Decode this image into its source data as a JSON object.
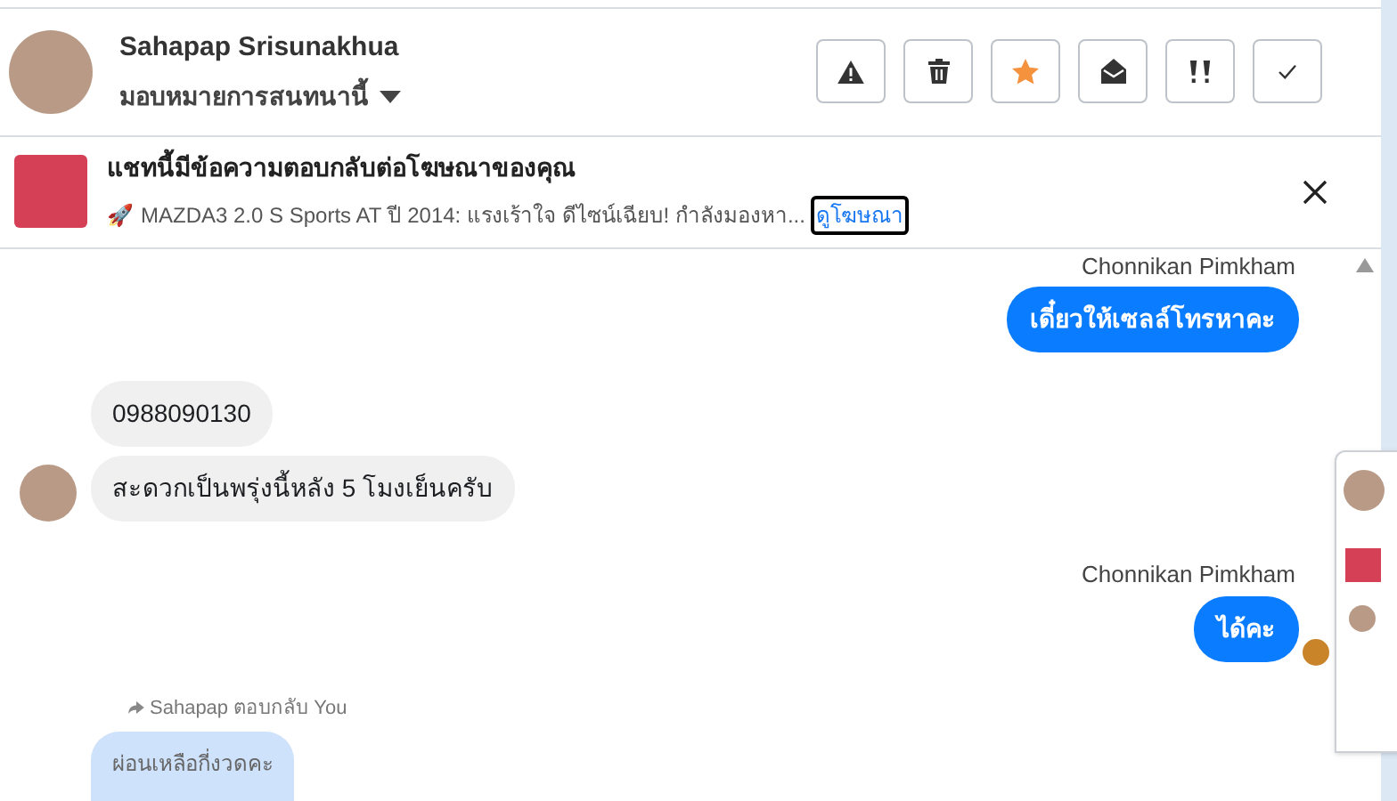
{
  "header": {
    "name": "Sahapap Srisunakhua",
    "assign_label": "มอบหมายการสนทนานี้"
  },
  "actions": [
    {
      "kind": "warning",
      "on": false
    },
    {
      "kind": "trash",
      "on": false
    },
    {
      "kind": "star",
      "on": true
    },
    {
      "kind": "envelope",
      "on": false
    },
    {
      "kind": "priority",
      "on": false
    },
    {
      "kind": "check",
      "on": false
    }
  ],
  "ad_banner": {
    "title": "แชทนี้มีข้อความตอบกลับต่อโฆษณาของคุณ",
    "icon": "🚀",
    "text": "MAZDA3 2.0 S Sports AT ปี 2014: แรงเร้าใจ ดีไซน์เฉียบ! กำลังมองหา...",
    "link": "ดูโฆษณา"
  },
  "messages": [
    {
      "kind": "sender",
      "text": "Chonnikan Pimkham"
    },
    {
      "kind": "outgoing",
      "text": "เดี๋ยวให้เซลล์โทรหาคะ",
      "seen": false
    },
    {
      "kind": "incoming",
      "text": "0988090130",
      "avatar": false
    },
    {
      "kind": "incoming",
      "text": "สะดวกเป็นพรุ่งนี้หลัง 5 โมงเย็นครับ",
      "avatar": true
    },
    {
      "kind": "sender",
      "text": "Chonnikan Pimkham"
    },
    {
      "kind": "outgoing",
      "text": "ได้คะ",
      "seen": true
    },
    {
      "kind": "reply_note",
      "text": "Sahapap ตอบกลับ You"
    },
    {
      "kind": "quoted",
      "text": "ผ่อนเหลือกี่งวดคะ"
    }
  ]
}
